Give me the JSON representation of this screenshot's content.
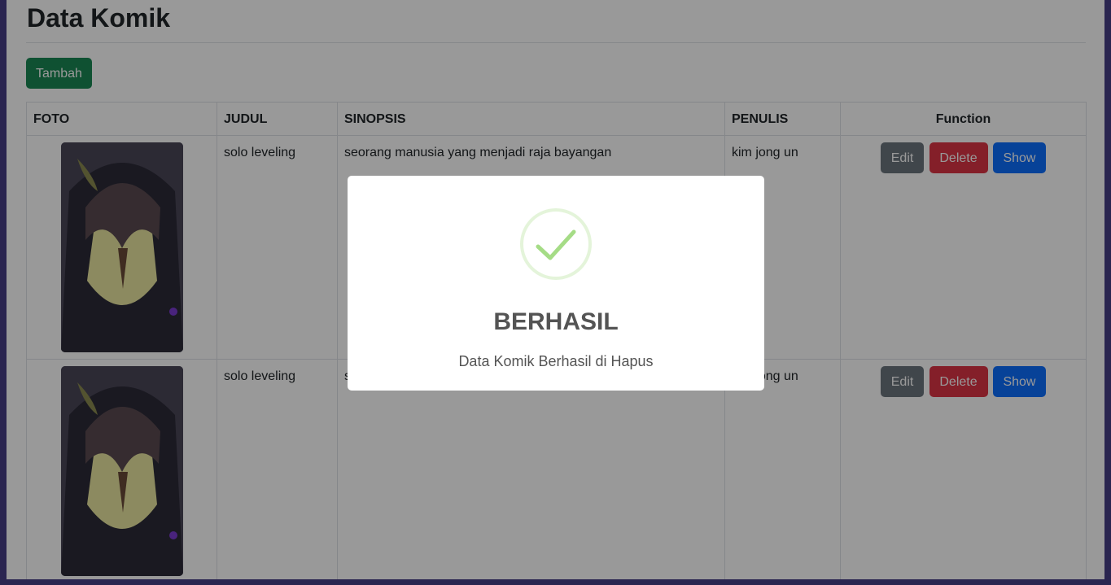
{
  "page": {
    "title": "Data Komik",
    "add_button": "Tambah"
  },
  "table": {
    "headers": {
      "foto": "FOTO",
      "judul": "JUDUL",
      "sinopsis": "SINOPSIS",
      "penulis": "PENULIS",
      "function": "Function"
    },
    "rows": [
      {
        "judul": "solo leveling",
        "sinopsis": "seorang manusia yang menjadi raja bayangan",
        "penulis": "kim jong un"
      },
      {
        "judul": "solo leveling",
        "sinopsis": "seorang manusia yang menjadi raja bayangan",
        "penulis": "kim jong un"
      }
    ],
    "actions": {
      "edit": "Edit",
      "delete": "Delete",
      "show": "Show"
    }
  },
  "modal": {
    "icon": "success-check-icon",
    "title": "BERHASIL",
    "text": "Data Komik Berhasil di Hapus"
  },
  "colors": {
    "success": "#198754",
    "secondary": "#6c757d",
    "danger": "#dc3545",
    "primary": "#0d6efd",
    "check": "#a5dc86"
  }
}
